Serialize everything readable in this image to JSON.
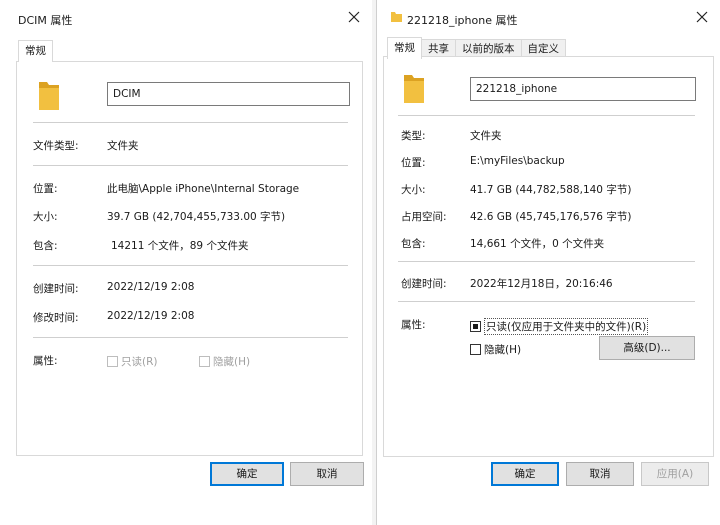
{
  "left": {
    "title": "DCIM 属性",
    "tab": "常规",
    "name": "DCIM",
    "rows": [
      {
        "label": "文件类型:",
        "value": "文件夹"
      },
      {
        "label": "位置:",
        "value": "此电脑\\Apple iPhone\\Internal Storage"
      },
      {
        "label": "大小:",
        "value": "39.7 GB (42,704,455,733.00 字节)"
      },
      {
        "label": "包含:",
        "value": "14211 个文件，89 个文件夹"
      },
      {
        "label": "创建时间:",
        "value": "2022/12/19 2:08"
      },
      {
        "label": "修改时间:",
        "value": "2022/12/19 2:08"
      }
    ],
    "attributes_label": "属性:",
    "readonly_label": "只读(R)",
    "hidden_label": "隐藏(H)",
    "ok": "确定",
    "cancel": "取消"
  },
  "right": {
    "title": "221218_iphone 属性",
    "tabs": [
      "常规",
      "共享",
      "以前的版本",
      "自定义"
    ],
    "name": "221218_iphone",
    "rows": [
      {
        "label": "类型:",
        "value": "文件夹"
      },
      {
        "label": "位置:",
        "value": "E:\\myFiles\\backup"
      },
      {
        "label": "大小:",
        "value": "41.7 GB (44,782,588,140 字节)"
      },
      {
        "label": "占用空间:",
        "value": "42.6 GB (45,745,176,576 字节)"
      },
      {
        "label": "包含:",
        "value": "14,661 个文件，0 个文件夹"
      },
      {
        "label": "创建时间:",
        "value": "2022年12月18日，20:16:46"
      }
    ],
    "attributes_label": "属性:",
    "readonly_label": "只读(仅应用于文件夹中的文件)(R)",
    "hidden_label": "隐藏(H)",
    "advanced": "高级(D)...",
    "ok": "确定",
    "cancel": "取消",
    "apply": "应用(A)"
  },
  "colors": {
    "folder": "#f2c040",
    "folder_dark": "#dca222",
    "accent": "#0078d7"
  },
  "icons": [
    "folder-icon",
    "close-icon"
  ]
}
